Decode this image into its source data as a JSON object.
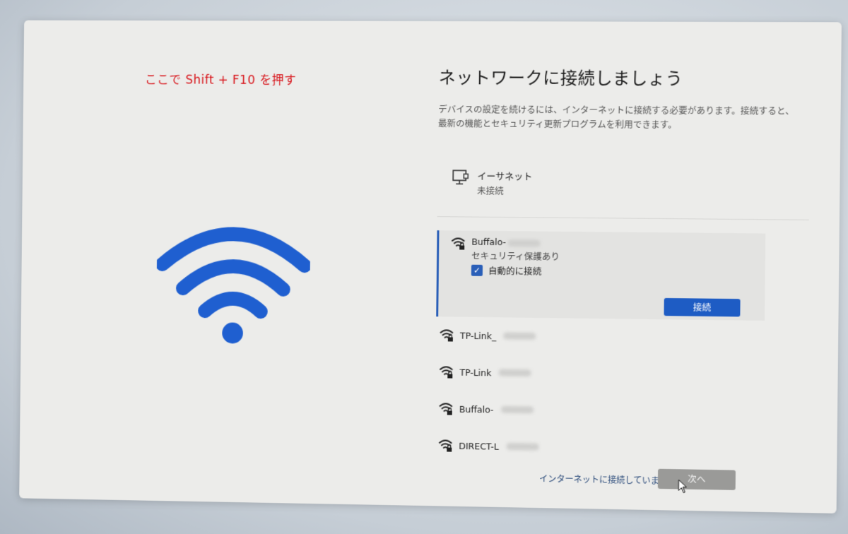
{
  "annotation": "ここで Shift + F10 を押す",
  "title": "ネットワークに接続しましょう",
  "description": "デバイスの設定を続けるには、インターネットに接続する必要があります。接続すると、最新の機能とセキュリティ更新プログラムを利用できます。",
  "ethernet": {
    "name": "イーサネット",
    "status": "未接続"
  },
  "selected_network": {
    "name": "Buffalo-",
    "security": "セキュリティ保護あり",
    "auto_connect_label": "自動的に接続",
    "auto_connect_checked": true,
    "connect_label": "接続"
  },
  "networks": [
    {
      "name": "TP-Link_"
    },
    {
      "name": "TP-Link"
    },
    {
      "name": "Buffalo-"
    },
    {
      "name": "DIRECT-L"
    }
  ],
  "footer": {
    "skip_text": "インターネットに接続していません",
    "next_label": "次へ"
  },
  "colors": {
    "accent": "#1e5cc4",
    "wifi_hero": "#1f5fd0",
    "annotation": "#d8161c"
  }
}
